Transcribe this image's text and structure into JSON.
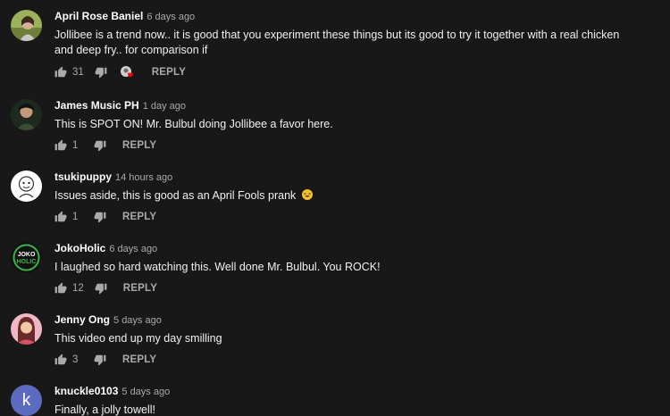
{
  "comments": [
    {
      "author": "April Rose Baniel",
      "time": "6 days ago",
      "text": "Jollibee is a trend now.. it is good that you experiment these things but its good to try it together with a real chicken and deep fry.. for comparison if",
      "likes": "31",
      "reply": "REPLY",
      "avatar_color": "#8aa04a",
      "creator_heart": true
    },
    {
      "author": "James Music PH",
      "time": "1 day ago",
      "text": "This is SPOT ON! Mr. Bulbul doing Jollibee a favor here.",
      "likes": "1",
      "reply": "REPLY",
      "avatar_color": "#2b3a2a"
    },
    {
      "author": "tsukipuppy",
      "time": "14 hours ago",
      "text": "Issues aside, this is good as an April Fools prank",
      "likes": "1",
      "reply": "REPLY",
      "avatar_color": "#ffffff",
      "emoji": "grinning-squinting-face"
    },
    {
      "author": "JokoHolic",
      "time": "6 days ago",
      "text": "I laughed so hard watching this. Well done Mr. Bulbul. You ROCK!",
      "likes": "12",
      "reply": "REPLY",
      "avatar_color": "#111111",
      "avatar_text": "JOKO HOLIC",
      "avatar_accent": "#39b54a"
    },
    {
      "author": "Jenny Ong",
      "time": "5 days ago",
      "text": "This video end up my day smilling",
      "likes": "3",
      "reply": "REPLY",
      "avatar_color": "#e8a8b4"
    },
    {
      "author": "knuckle0103",
      "time": "5 days ago",
      "text": "Finally, a jolly towell!",
      "avatar_color": "#5c6bc0",
      "avatar_letter": "k"
    }
  ],
  "colors": {
    "background": "#181818",
    "text": "#f1f1f1",
    "secondary": "#aaaaaa",
    "heart": "#ff0000"
  }
}
